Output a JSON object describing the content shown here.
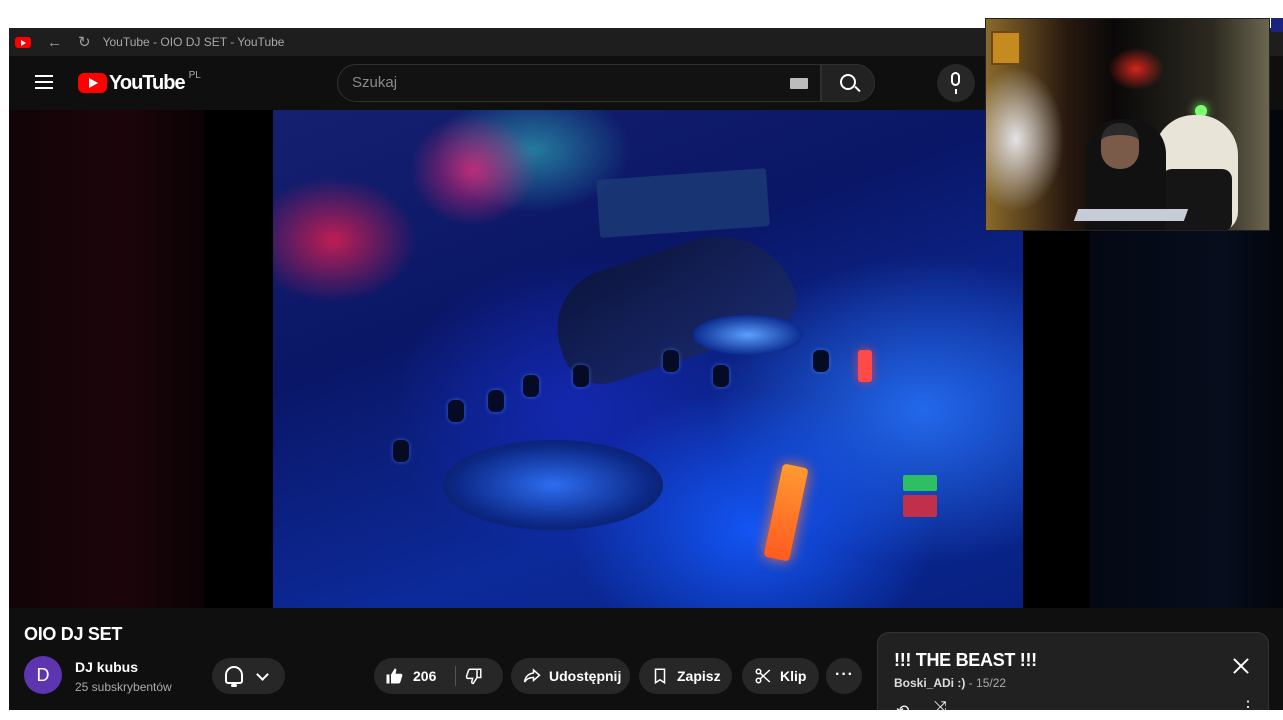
{
  "browser": {
    "tab_title": "YouTube - OIO DJ SET - YouTube",
    "back_icon": "arrow-left-icon",
    "reload_icon": "reload-icon"
  },
  "masthead": {
    "logo_text": "YouTube",
    "country_code": "PL",
    "search_placeholder": "Szukaj",
    "menu_icon": "hamburger-icon",
    "search_icon": "search-icon",
    "mic_icon": "mic-icon",
    "keyboard_icon": "keyboard-icon"
  },
  "video": {
    "title": "OIO DJ SET",
    "channel": {
      "avatar_letter": "D",
      "name": "DJ kubus",
      "subscribers": "25 subskrybentów"
    },
    "actions": {
      "likes": "206",
      "share": "Udostępnij",
      "save": "Zapisz",
      "clip": "Klip",
      "more": "···"
    }
  },
  "playlist": {
    "title": "!!! THE BEAST !!!",
    "owner": "Boski_ADi :)",
    "separator": " - ",
    "position": "15/22"
  },
  "colors": {
    "brand_red": "#ff0000",
    "background": "#0f0f0f",
    "pill": "#272727",
    "avatar": "#5e35b1"
  }
}
